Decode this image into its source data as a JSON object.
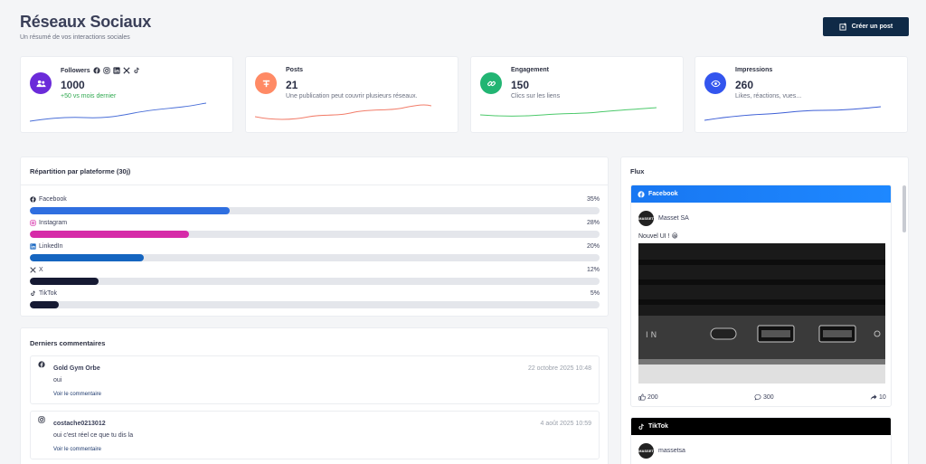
{
  "header": {
    "title": "Réseaux Sociaux",
    "subtitle": "Un résumé de vos interactions sociales",
    "create_button": "Créer un post"
  },
  "stats": [
    {
      "label": "Followers",
      "value": "1000",
      "sub": "+50 vs mois dernier",
      "icon": "users-icon",
      "color": "#6b2bd9"
    },
    {
      "label": "Posts",
      "value": "21",
      "sub": "Une publication peut couvrir plusieurs réseaux.",
      "icon": "document-icon",
      "color": "#ff8a65"
    },
    {
      "label": "Engagement",
      "value": "150",
      "sub": "Clics sur les liens",
      "icon": "link-icon",
      "color": "#22b573"
    },
    {
      "label": "Impressions",
      "value": "260",
      "sub": "Likes, réactions, vues...",
      "icon": "eye-icon",
      "color": "#3355ee"
    }
  ],
  "distribution": {
    "title": "Répartition par plateforme (30j)",
    "platforms": [
      {
        "name": "Facebook",
        "pct": "35%",
        "value": 35,
        "color": "#2f6fe0"
      },
      {
        "name": "Instagram",
        "pct": "28%",
        "value": 28,
        "color": "#d62ba8"
      },
      {
        "name": "LinkedIn",
        "pct": "20%",
        "value": 20,
        "color": "#1565c0"
      },
      {
        "name": "X",
        "pct": "12%",
        "value": 12,
        "color": "#161a33"
      },
      {
        "name": "TikTok",
        "pct": "5%",
        "value": 5,
        "color": "#161a33"
      }
    ]
  },
  "comments": {
    "title": "Derniers commentaires",
    "items": [
      {
        "platform": "facebook",
        "author": "Gold Gym Orbe",
        "date": "22 octobre 2025 10:48",
        "text": "oui",
        "link": "Voir le commentaire"
      },
      {
        "platform": "instagram",
        "author": "costache0213012",
        "date": "4 août 2025 10:59",
        "text": "oui c'est réel ce que tu dis la",
        "link": "Voir le commentaire"
      }
    ]
  },
  "feed": {
    "title": "Flux",
    "posts": [
      {
        "platform": "Facebook",
        "author": "Masset SA",
        "text": "Nouvel UI ! 😀",
        "likes": "200",
        "comments": "300",
        "shares": "10",
        "header_color": "#1877f2"
      },
      {
        "platform": "TikTok",
        "author": "massetsa",
        "header_color": "#000000"
      }
    ]
  },
  "brand": {
    "avatar_text": "MASSET"
  }
}
